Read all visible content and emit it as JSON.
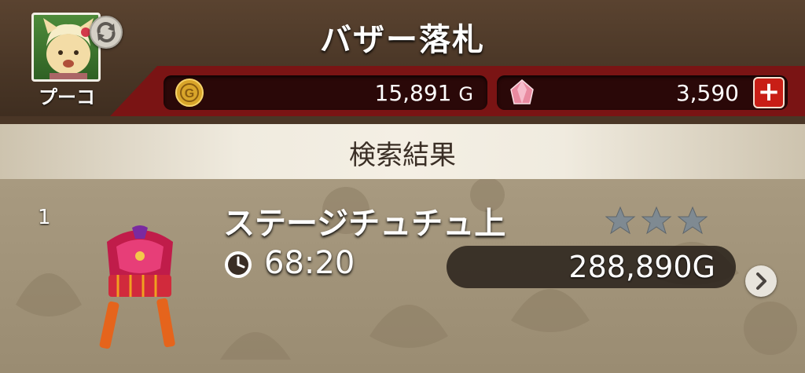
{
  "header": {
    "title": "バザー落札",
    "avatar": {
      "name": "プーコ",
      "icon": "character-portrait",
      "switch_icon": "refresh-icon"
    }
  },
  "currency": {
    "gold": {
      "value": "15,891",
      "unit": "G",
      "icon": "gold-coin-icon"
    },
    "gems": {
      "value": "3,590",
      "icon": "gem-icon",
      "add_button": "+"
    }
  },
  "results": {
    "label": "検索結果"
  },
  "items": [
    {
      "number": "1",
      "name": "ステージチュチュ上",
      "stars": 0,
      "stars_max": 3,
      "time": "68:20",
      "price": "288,890G",
      "icon": "costume-top-icon"
    }
  ],
  "colors": {
    "accent_red": "#7a1414",
    "plus_red": "#c81e16",
    "band": "#f0ebdf"
  }
}
